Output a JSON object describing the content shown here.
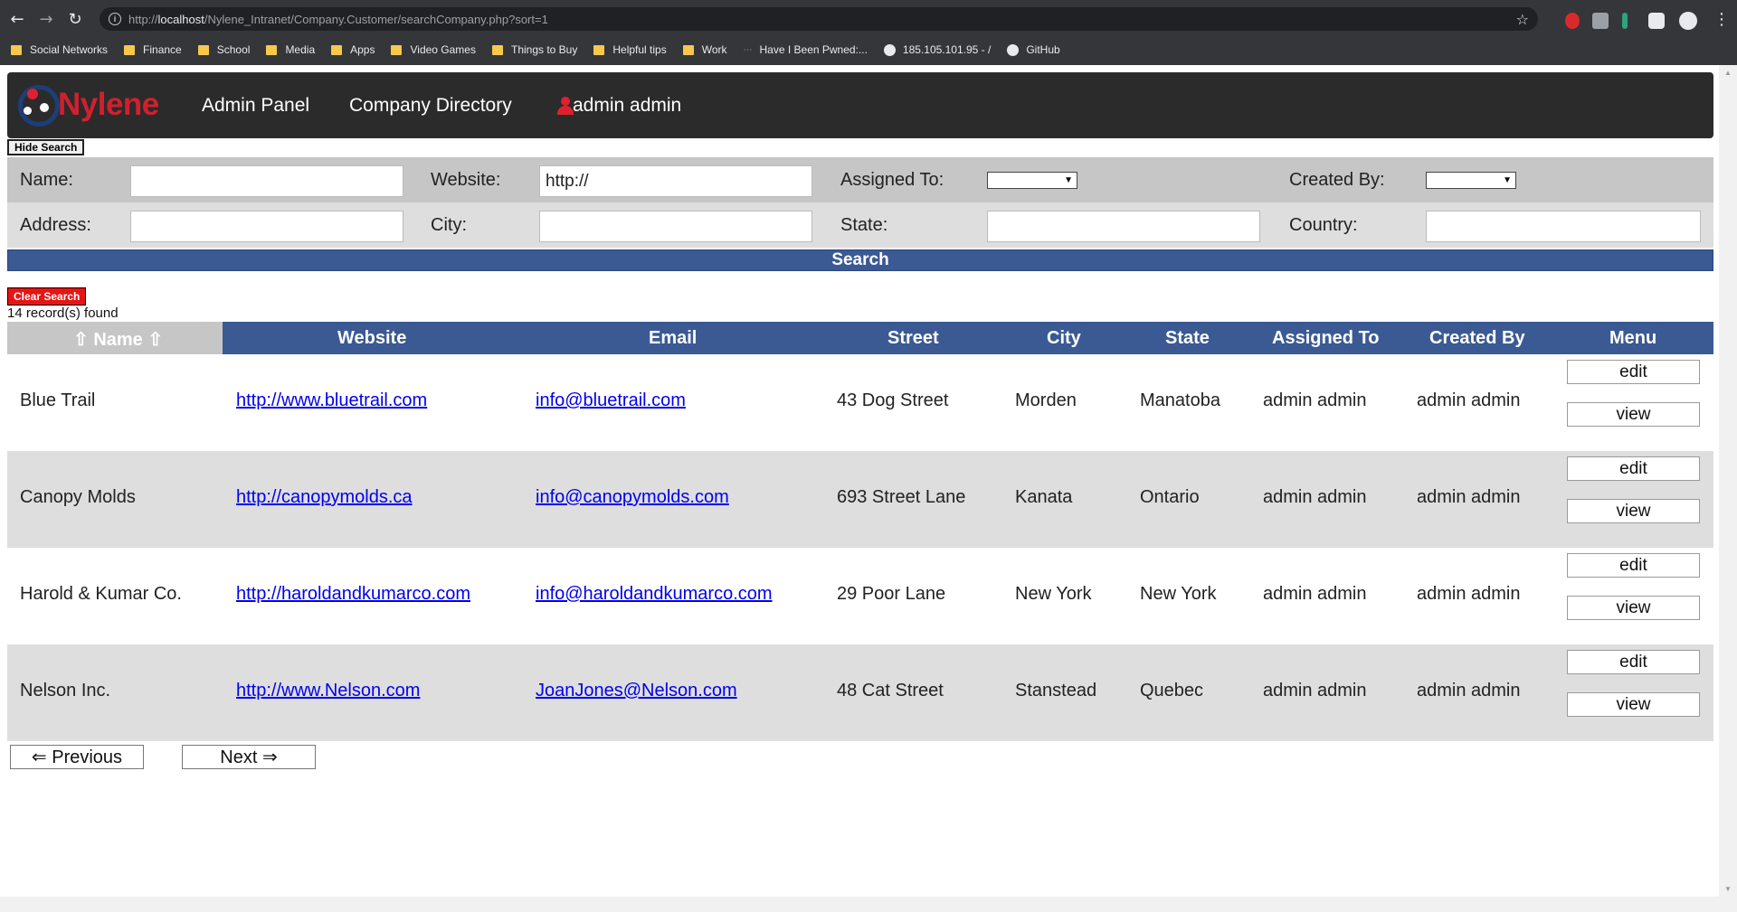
{
  "browser": {
    "url_prefix": "http://",
    "url_host": "localhost",
    "url_path": "/Nylene_Intranet/Company.Customer/searchCompany.php?sort=1",
    "bookmarks": [
      "Social Networks",
      "Finance",
      "School",
      "Media",
      "Apps",
      "Video Games",
      "Things to Buy",
      "Helpful tips",
      "Work",
      "Have I Been Pwned:...",
      "185.105.101.95 - /",
      "GitHub"
    ]
  },
  "header": {
    "logo_text": "Nylene",
    "nav": [
      "Admin Panel",
      "Company Directory"
    ],
    "user": "admin admin"
  },
  "search": {
    "hide_label": "Hide Search",
    "name_label": "Name:",
    "website_label": "Website:",
    "website_value": "http://",
    "assigned_label": "Assigned To:",
    "created_label": "Created By:",
    "address_label": "Address:",
    "city_label": "City:",
    "state_label": "State:",
    "country_label": "Country:",
    "search_label": "Search",
    "clear_label": "Clear Search",
    "records_found": "14 record(s) found"
  },
  "table": {
    "headers": [
      "⇧ Name ⇧",
      "Website",
      "Email",
      "Street",
      "City",
      "State",
      "Assigned To",
      "Created By",
      "Menu"
    ],
    "edit_label": "edit",
    "view_label": "view",
    "rows": [
      {
        "name": "Blue Trail",
        "website": "http://www.bluetrail.com",
        "email": "info@bluetrail.com",
        "street": "43 Dog Street",
        "city": "Morden",
        "state": "Manatoba",
        "assigned": "admin admin",
        "created": "admin admin"
      },
      {
        "name": "Canopy Molds",
        "website": "http://canopymolds.ca",
        "email": "info@canopymolds.com",
        "street": "693 Street Lane",
        "city": "Kanata",
        "state": "Ontario",
        "assigned": "admin admin",
        "created": "admin admin"
      },
      {
        "name": "Harold & Kumar Co.",
        "website": "http://haroldandkumarco.com",
        "email": "info@haroldandkumarco.com",
        "street": "29 Poor Lane",
        "city": "New York",
        "state": "New York",
        "assigned": "admin admin",
        "created": "admin admin"
      },
      {
        "name": "Nelson Inc.",
        "website": "http://www.Nelson.com",
        "email": "JoanJones@Nelson.com",
        "street": "48 Cat Street",
        "city": "Stanstead",
        "state": "Quebec",
        "assigned": "admin admin",
        "created": "admin admin"
      }
    ]
  },
  "pager": {
    "prev_label": "⇐ Previous",
    "next_label": "Next ⇒"
  }
}
